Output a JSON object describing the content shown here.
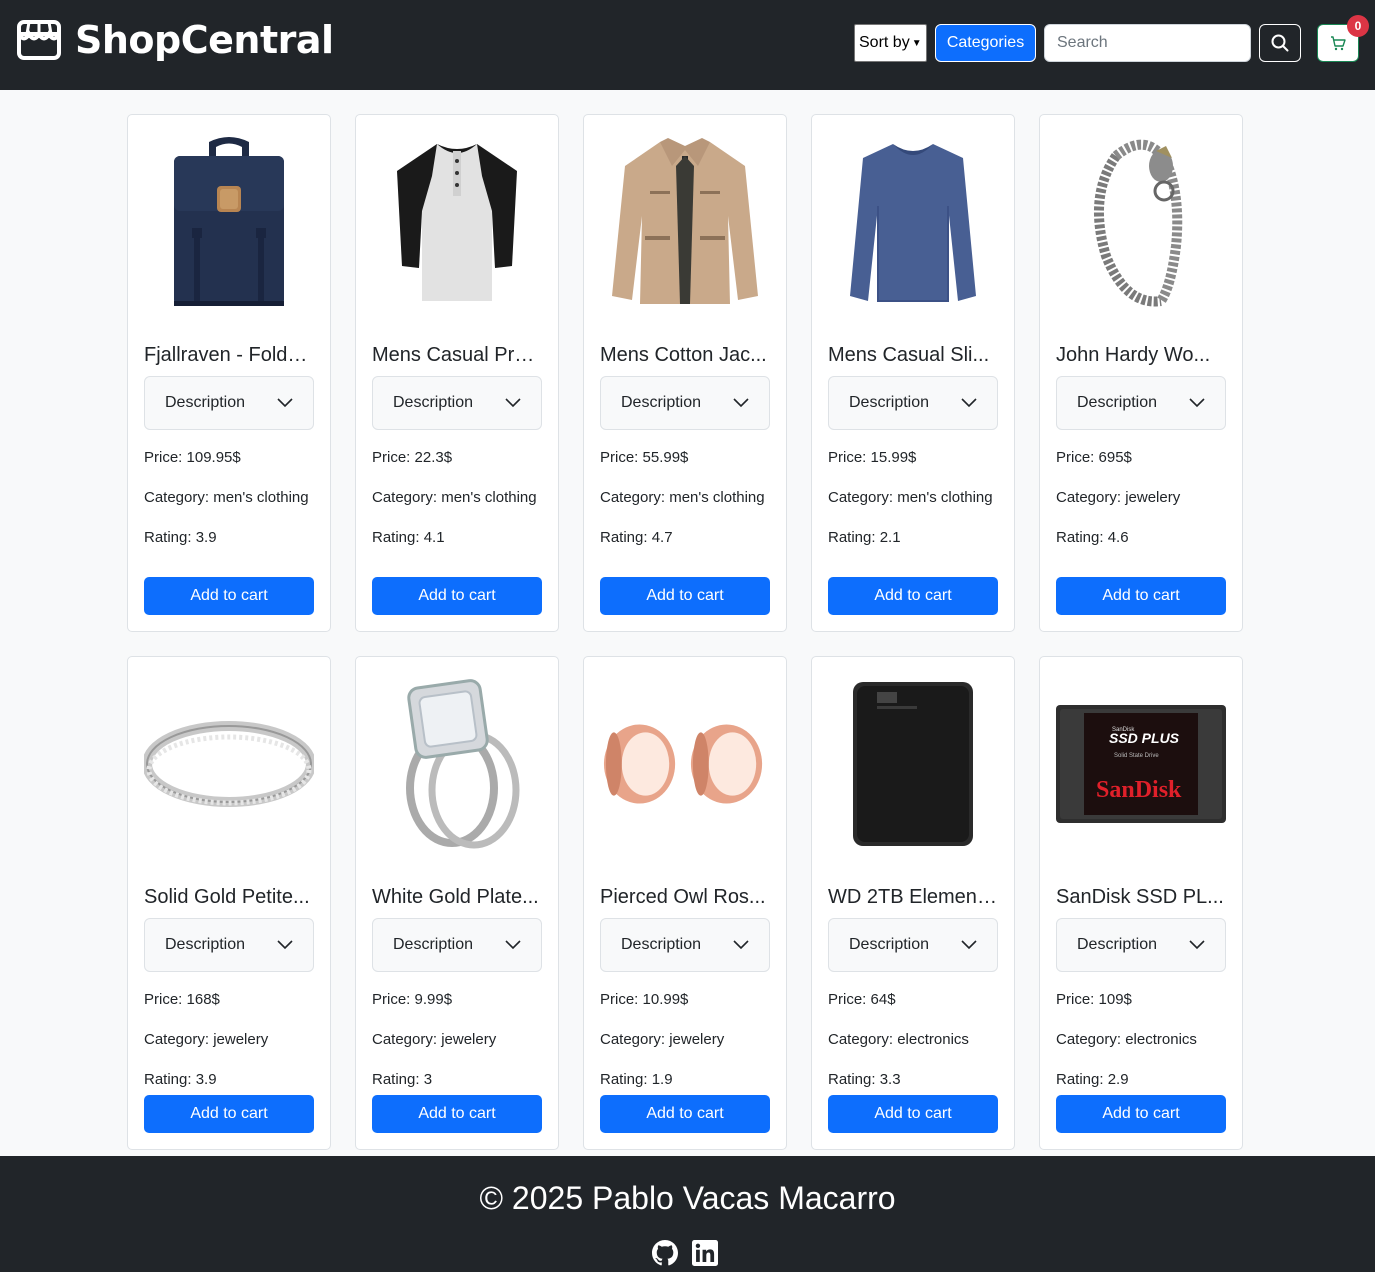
{
  "header": {
    "brand": "ShopCentral",
    "sort_label": "Sort by",
    "categories_label": "Categories",
    "search_placeholder": "Search",
    "cart_count": "0"
  },
  "products": [
    {
      "title": "Fjallraven - Folds...",
      "description": "Description",
      "price": "Price: 109.95$",
      "category": "Category: men's clothing",
      "rating": "Rating: 3.9",
      "add": "Add to cart",
      "image": "backpack"
    },
    {
      "title": "Mens Casual Pre...",
      "description": "Description",
      "price": "Price: 22.3$",
      "category": "Category: men's clothing",
      "rating": "Rating: 4.1",
      "add": "Add to cart",
      "image": "raglan-tshirt"
    },
    {
      "title": "Mens Cotton Jac...",
      "description": "Description",
      "price": "Price: 55.99$",
      "category": "Category: men's clothing",
      "rating": "Rating: 4.7",
      "add": "Add to cart",
      "image": "cotton-jacket"
    },
    {
      "title": "Mens Casual Sli...",
      "description": "Description",
      "price": "Price: 15.99$",
      "category": "Category: men's clothing",
      "rating": "Rating: 2.1",
      "add": "Add to cart",
      "image": "blue-longsleeve"
    },
    {
      "title": "John Hardy Wo...",
      "description": "Description",
      "price": "Price: 695$",
      "category": "Category: jewelery",
      "rating": "Rating: 4.6",
      "add": "Add to cart",
      "image": "chain-bracelet"
    },
    {
      "title": "Solid Gold Petite...",
      "description": "Description",
      "price": "Price: 168$",
      "category": "Category: jewelery",
      "rating": "Rating: 3.9",
      "add": "Add to cart",
      "image": "diamond-band"
    },
    {
      "title": "White Gold Plate...",
      "description": "Description",
      "price": "Price: 9.99$",
      "category": "Category: jewelery",
      "rating": "Rating: 3",
      "add": "Add to cart",
      "image": "engagement-ring"
    },
    {
      "title": "Pierced Owl Ros...",
      "description": "Description",
      "price": "Price: 10.99$",
      "category": "Category: jewelery",
      "rating": "Rating: 1.9",
      "add": "Add to cart",
      "image": "rose-gold-plugs"
    },
    {
      "title": "WD 2TB Element...",
      "description": "Description",
      "price": "Price: 64$",
      "category": "Category: electronics",
      "rating": "Rating: 3.3",
      "add": "Add to cart",
      "image": "hard-drive"
    },
    {
      "title": "SanDisk SSD PL...",
      "description": "Description",
      "price": "Price: 109$",
      "category": "Category: electronics",
      "rating": "Rating: 2.9",
      "add": "Add to cart",
      "image": "ssd"
    }
  ],
  "ssd_label": {
    "top": "SSD PLUS",
    "sub": "Solid State Drive",
    "brand": "SanDisk",
    "small": "SanDisk"
  },
  "footer": {
    "copyright": "© 2025 Pablo Vacas Macarro",
    "icons": [
      "github-icon",
      "linkedin-icon"
    ]
  },
  "colors": {
    "navbar": "#212529",
    "primary": "#0d6efd",
    "badge": "#dc3545",
    "cart_border": "#198754"
  }
}
